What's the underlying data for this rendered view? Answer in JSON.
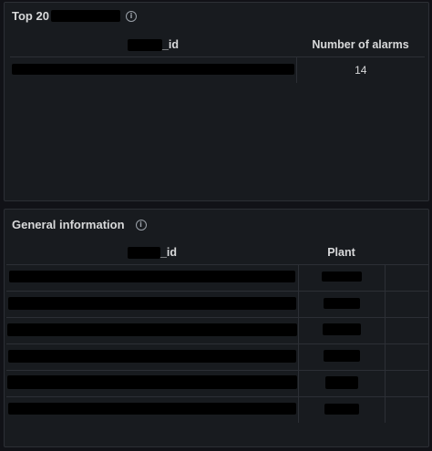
{
  "panels": [
    {
      "title_visible": "Top 20",
      "columns": [
        "_id",
        "Number of alarms"
      ],
      "rows": [
        {
          "alarms": "14"
        }
      ]
    },
    {
      "title": "General information",
      "columns": [
        "_id",
        "Plant"
      ],
      "row_count": 6
    }
  ],
  "info_glyph": "i"
}
